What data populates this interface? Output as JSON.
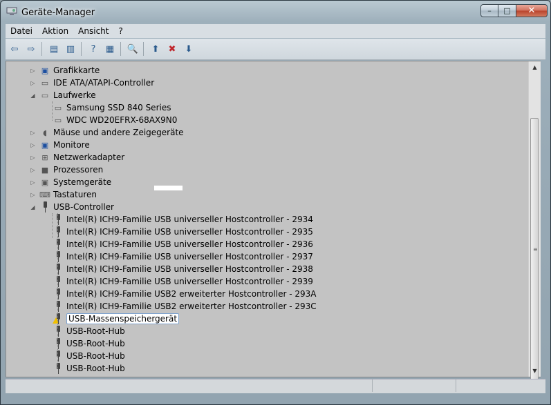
{
  "window": {
    "title": "Geräte-Manager",
    "min": "–",
    "max": "□",
    "close": "✕"
  },
  "menu": [
    "Datei",
    "Aktion",
    "Ansicht",
    "?"
  ],
  "toolbar": [
    {
      "icon": "back-icon",
      "glyph": "⇦"
    },
    {
      "icon": "forward-icon",
      "glyph": "⇨"
    },
    {
      "icon": "show-hide-console-tree-icon",
      "glyph": "▤"
    },
    {
      "icon": "properties-icon",
      "glyph": "▥"
    },
    {
      "icon": "help-icon",
      "glyph": "?"
    },
    {
      "icon": "action-pane-icon",
      "glyph": "▦"
    },
    {
      "icon": "scan-hardware-icon",
      "glyph": "🔍"
    },
    {
      "icon": "update-driver-icon",
      "glyph": "⬆"
    },
    {
      "icon": "uninstall-icon",
      "glyph": "✖"
    },
    {
      "icon": "disable-icon",
      "glyph": "⬇"
    }
  ],
  "tree": [
    {
      "label": "Grafikkarte",
      "level": 0,
      "exp": "▷",
      "icon": "display-adapter-icon"
    },
    {
      "label": "IDE ATA/ATAPI-Controller",
      "level": 0,
      "exp": "▷",
      "icon": "ide-controller-icon"
    },
    {
      "label": "Laufwerke",
      "level": 0,
      "exp": "◢",
      "icon": "disk-drives-icon"
    },
    {
      "label": "Samsung SSD 840 Series",
      "level": 1,
      "icon": "disk-icon"
    },
    {
      "label": "WDC WD20EFRX-68AX9N0",
      "level": 1,
      "icon": "disk-icon"
    },
    {
      "label": "Mäuse und andere Zeigegeräte",
      "level": 0,
      "exp": "▷",
      "icon": "mouse-icon"
    },
    {
      "label": "Monitore",
      "level": 0,
      "exp": "▷",
      "icon": "monitor-icon"
    },
    {
      "label": "Netzwerkadapter",
      "level": 0,
      "exp": "▷",
      "icon": "network-adapter-icon"
    },
    {
      "label": "Prozessoren",
      "level": 0,
      "exp": "▷",
      "icon": "processor-icon"
    },
    {
      "label": "Systemgeräte",
      "level": 0,
      "exp": "▷",
      "icon": "system-devices-icon"
    },
    {
      "label": "Tastaturen",
      "level": 0,
      "exp": "▷",
      "icon": "keyboard-icon"
    },
    {
      "label": "USB-Controller",
      "level": 0,
      "exp": "◢",
      "icon": "usb-icon"
    },
    {
      "label": "Intel(R) ICH9-Familie USB universeller Hostcontroller - 2934",
      "level": 1,
      "icon": "usb-icon"
    },
    {
      "label": "Intel(R) ICH9-Familie USB universeller Hostcontroller - 2935",
      "level": 1,
      "icon": "usb-icon"
    },
    {
      "label": "Intel(R) ICH9-Familie USB universeller Hostcontroller - 2936",
      "level": 1,
      "icon": "usb-icon"
    },
    {
      "label": "Intel(R) ICH9-Familie USB universeller Hostcontroller - 2937",
      "level": 1,
      "icon": "usb-icon"
    },
    {
      "label": "Intel(R) ICH9-Familie USB universeller Hostcontroller - 2938",
      "level": 1,
      "icon": "usb-icon"
    },
    {
      "label": "Intel(R) ICH9-Familie USB universeller Hostcontroller - 2939",
      "level": 1,
      "icon": "usb-icon"
    },
    {
      "label": "Intel(R) ICH9-Familie USB2 erweiterter Hostcontroller - 293A",
      "level": 1,
      "icon": "usb-icon"
    },
    {
      "label": "Intel(R) ICH9-Familie USB2 erweiterter Hostcontroller - 293C",
      "level": 1,
      "icon": "usb-icon"
    },
    {
      "label": "USB-Massenspeichergerät",
      "level": 1,
      "icon": "usb-warning-icon",
      "selected": true,
      "warning": true
    },
    {
      "label": "USB-Root-Hub",
      "level": 1,
      "icon": "usb-icon"
    },
    {
      "label": "USB-Root-Hub",
      "level": 1,
      "icon": "usb-icon"
    },
    {
      "label": "USB-Root-Hub",
      "level": 1,
      "icon": "usb-icon"
    },
    {
      "label": "USB-Root-Hub",
      "level": 1,
      "icon": "usb-icon"
    }
  ],
  "scrollbar": {
    "up": "▲",
    "down": "▼",
    "grip": "≡"
  },
  "colors": {
    "selection_border": "#7da2ce",
    "warning": "#f0c000",
    "close_button": "#c74a33"
  }
}
